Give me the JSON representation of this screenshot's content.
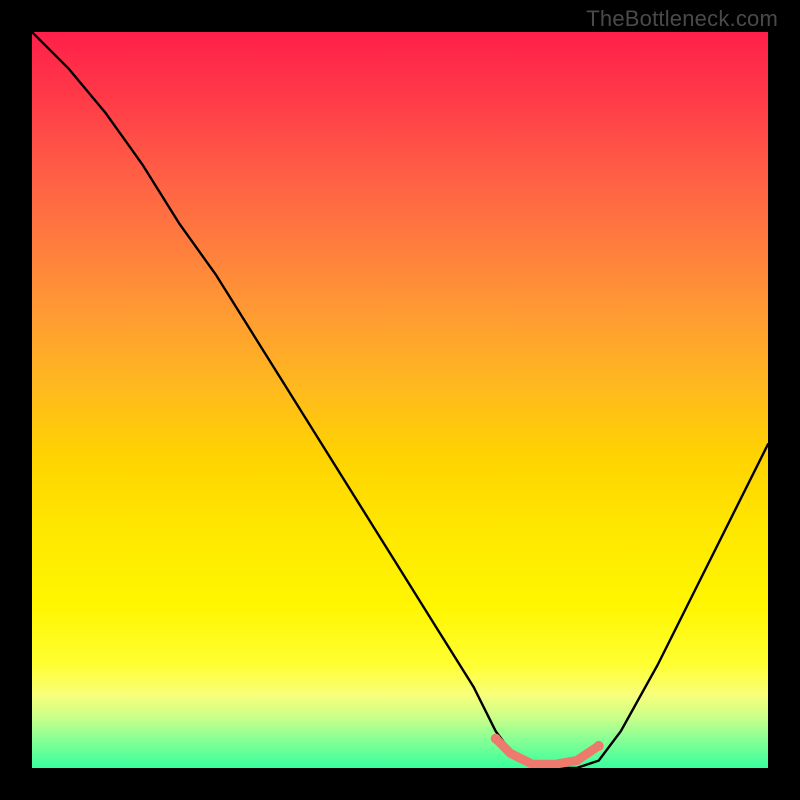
{
  "watermark": {
    "text": "TheBottleneck.com"
  },
  "chart_data": {
    "type": "line",
    "title": "",
    "xlabel": "",
    "ylabel": "",
    "xlim": [
      0,
      100
    ],
    "ylim": [
      0,
      100
    ],
    "series": [
      {
        "name": "bottleneck-curve",
        "x": [
          0,
          5,
          10,
          15,
          20,
          25,
          30,
          35,
          40,
          45,
          50,
          55,
          60,
          63,
          66,
          70,
          74,
          77,
          80,
          85,
          90,
          95,
          100
        ],
        "values": [
          100,
          95,
          89,
          82,
          74,
          67,
          59,
          51,
          43,
          35,
          27,
          19,
          11,
          5,
          1,
          0,
          0,
          1,
          5,
          14,
          24,
          34,
          44
        ]
      }
    ],
    "highlight": {
      "name": "valley-highlight",
      "color": "#ee7a6d",
      "x": [
        63,
        65,
        68,
        71,
        74,
        77
      ],
      "values": [
        4,
        2,
        0.5,
        0.5,
        1,
        3
      ]
    }
  }
}
